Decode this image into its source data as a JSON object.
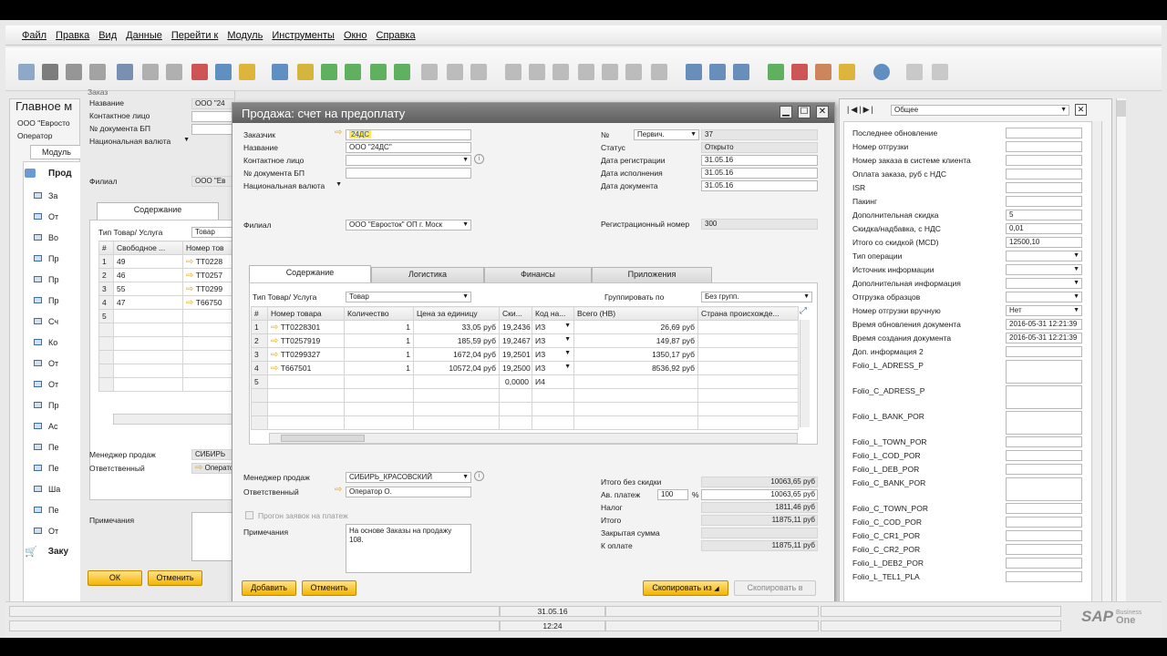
{
  "menu": [
    "Файл",
    "Правка",
    "Вид",
    "Данные",
    "Перейти к",
    "Модуль",
    "Инструменты",
    "Окно",
    "Справка"
  ],
  "back": {
    "title": "Главное м",
    "company": "ООО \"Евросто",
    "operator": "Оператор",
    "tab": "Модуль",
    "section": "Прод",
    "items": [
      "За",
      "От",
      "Во",
      "Пр",
      "Пр",
      "Пр",
      "Сч",
      "Ко",
      "От",
      "От",
      "Пр",
      "Ас",
      "Пе",
      "Пе",
      "Ша",
      "Пе",
      "От"
    ],
    "last": "Заку"
  },
  "bg_doc": {
    "topcut": "Заказ",
    "name_label": "Название",
    "name_val": "ООО \"24",
    "contact_label": "Контактное лицо",
    "docnum_label": "№ документа БП",
    "currency": "Национальная валюта",
    "branch_label": "Филиал",
    "branch_val": "ООО \"Ев",
    "tab": "Содержание",
    "type_label": "Тип Товар/ Услуга",
    "type_val": "Товар",
    "col_num": "#",
    "col_free": "Свободное ...",
    "col_item": "Номер тов",
    "rows": [
      [
        "1",
        "49",
        "ТТ0228"
      ],
      [
        "2",
        "46",
        "ТТ0257"
      ],
      [
        "3",
        "55",
        "ТТ0299"
      ],
      [
        "4",
        "47",
        "Т66750"
      ],
      [
        "5",
        "",
        ""
      ]
    ],
    "manager_label": "Менеджер продаж",
    "manager_val": "СИБИРЬ",
    "resp_label": "Ответственный",
    "resp_val": "Операто",
    "notes_label": "Примечания",
    "ok": "ОК",
    "cancel": "Отменить"
  },
  "dialog": {
    "title": "Продажа: счет на предоплату",
    "customer_label": "Заказчик",
    "customer_val": "24ДС",
    "name_label": "Название",
    "name_val": "ООО \"24ДС\"",
    "contact_label": "Контактное лицо",
    "docnum_label": "№ документа БП",
    "currency": "Национальная валюта",
    "branch_label": "Филиал",
    "branch_val": "ООО \"Евросток\" ОП г. Моск",
    "num_label": "№",
    "series": "Первич.",
    "num_val": "37",
    "status_label": "Статус",
    "status_val": "Открыто",
    "regdate_label": "Дата регистрации",
    "regdate_val": "31.05.16",
    "duedate_label": "Дата исполнения",
    "duedate_val": "31.05.16",
    "docdate_label": "Дата документа",
    "docdate_val": "31.05.16",
    "regnum_label": "Регистрационный номер",
    "regnum_val": "300",
    "tabs": [
      "Содержание",
      "Логистика",
      "Финансы",
      "Приложения"
    ],
    "type_label": "Тип Товар/ Услуга",
    "type_val": "Товар",
    "group_label": "Группировать по",
    "group_val": "Без групп.",
    "columns": [
      "#",
      "Номер товара",
      "Количество",
      "Цена за единицу",
      "Ски...",
      "Код на...",
      "Всего (НВ)",
      "Страна происхожде..."
    ],
    "rows": [
      [
        "1",
        "ТТ0228301",
        "1",
        "33,05 руб",
        "19,2436",
        "ИЗ",
        "26,69 руб",
        ""
      ],
      [
        "2",
        "ТТ0257919",
        "1",
        "185,59 руб",
        "19,2467",
        "ИЗ",
        "149,87 руб",
        ""
      ],
      [
        "3",
        "ТТ0299327",
        "1",
        "1672,04 руб",
        "19,2501",
        "ИЗ",
        "1350,17 руб",
        ""
      ],
      [
        "4",
        "Т667501",
        "1",
        "10572,04 руб",
        "19,2500",
        "ИЗ",
        "8536,92 руб",
        ""
      ],
      [
        "5",
        "",
        "",
        "",
        "0,0000",
        "И4",
        "",
        ""
      ]
    ],
    "manager_label": "Менеджер продаж",
    "manager_val": "СИБИРЬ_КРАСОВСКИЙ",
    "resp_label": "Ответственный",
    "resp_val": "Оператор О.",
    "run_label": "Прогон заявок на платеж",
    "notes_label": "Примечания",
    "notes_val": "На основе Заказы на продажу 108.",
    "total_nodisc_label": "Итого без скидки",
    "total_nodisc_val": "10063,65 руб",
    "advance_label": "Ав. платеж",
    "advance_pct": "100",
    "pct": "%",
    "advance_val": "10063,65 руб",
    "tax_label": "Налог",
    "tax_val": "1811,46 руб",
    "total_label": "Итого",
    "total_val": "11875,11 руб",
    "closed_label": "Закрытая сумма",
    "closed_val": "",
    "topay_label": "К оплате",
    "topay_val": "11875,11 руб",
    "add": "Добавить",
    "cancel": "Отменить",
    "copy_from": "Скопировать из",
    "copy_to": "Скопировать в"
  },
  "udf": {
    "category": "Общее",
    "rows": [
      {
        "label": "Последнее обновление",
        "val": ""
      },
      {
        "label": "Номер отгрузки",
        "val": ""
      },
      {
        "label": "Номер заказа в системе клиента",
        "val": ""
      },
      {
        "label": "Оплата заказа, руб с НДС",
        "val": ""
      },
      {
        "label": "ISR",
        "val": ""
      },
      {
        "label": "Пакинг",
        "val": ""
      },
      {
        "label": "Дополнительная скидка",
        "val": "5"
      },
      {
        "label": "Скидка/надбавка, с НДС",
        "val": "0,01"
      },
      {
        "label": "Итого со скидкой (MCD)",
        "val": "12500,10"
      },
      {
        "label": "Тип операции",
        "val": ""
      },
      {
        "label": "Источник информации",
        "val": ""
      },
      {
        "label": "Дополнительная информация",
        "val": ""
      },
      {
        "label": "Отгрузка образцов",
        "val": ""
      },
      {
        "label": "Номер отгрузки вручную",
        "val": "Нет"
      },
      {
        "label": "Время обновления документа",
        "val": "2016-05-31 12:21:39"
      },
      {
        "label": "Время создания документа",
        "val": "2016-05-31 12:21:39"
      },
      {
        "label": "Доп. информация 2",
        "val": ""
      }
    ],
    "folio": [
      "Folio_L_ADRESS_P",
      "Folio_C_ADRESS_P",
      "Folio_L_BANK_POR",
      "Folio_L_TOWN_POR",
      "Folio_L_COD_POR",
      "Folio_L_DEB_POR",
      "Folio_C_BANK_POR",
      "Folio_C_TOWN_POR",
      "Folio_C_COD_POR",
      "Folio_C_CR1_POR",
      "Folio_C_CR2_POR",
      "Folio_L_DEB2_POR",
      "Folio_L_TEL1_PLA"
    ]
  },
  "status": {
    "date": "31.05.16",
    "time": "12:24",
    "brand": "SAP",
    "brand_sub1": "Business",
    "brand_sub2": "One"
  }
}
